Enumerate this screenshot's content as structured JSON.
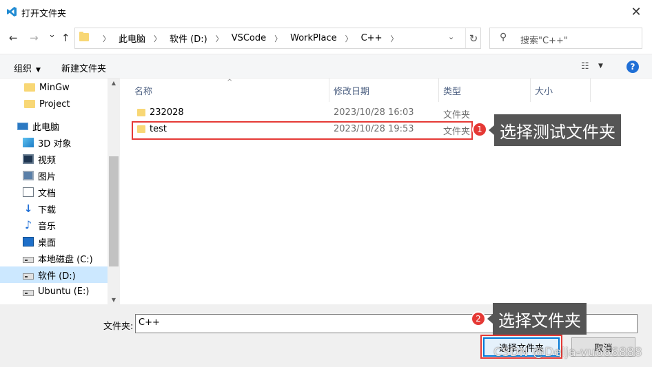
{
  "window": {
    "title": "打开文件夹",
    "close_glyph": "✕"
  },
  "nav": {
    "back_glyph": "←",
    "forward_glyph": "→",
    "recent_glyph": "⌄",
    "up_glyph": "↑",
    "breadcrumbs": [
      "此电脑",
      "软件 (D:)",
      "VSCode",
      "WorkPlace",
      "C++"
    ],
    "refresh_glyph": "↻",
    "search_placeholder": "搜索\"C++\""
  },
  "toolbar": {
    "organize_label": "组织",
    "new_folder_label": "新建文件夹",
    "help_label": "?"
  },
  "sidebar": {
    "items": [
      {
        "label": "MinGw",
        "icon": "folder-icon"
      },
      {
        "label": "Project",
        "icon": "folder-icon"
      },
      {
        "label": "此电脑",
        "icon": "computer-icon"
      },
      {
        "label": "3D 对象",
        "icon": "3d-objects-icon"
      },
      {
        "label": "视频",
        "icon": "video-icon"
      },
      {
        "label": "图片",
        "icon": "pictures-icon"
      },
      {
        "label": "文档",
        "icon": "documents-icon"
      },
      {
        "label": "下载",
        "icon": "download-icon"
      },
      {
        "label": "音乐",
        "icon": "music-icon"
      },
      {
        "label": "桌面",
        "icon": "desktop-icon"
      },
      {
        "label": "本地磁盘 (C:)",
        "icon": "drive-icon"
      },
      {
        "label": "软件 (D:)",
        "icon": "drive-icon",
        "selected": true
      },
      {
        "label": "Ubuntu (E:)",
        "icon": "drive-icon"
      }
    ]
  },
  "filelist": {
    "columns": [
      "名称",
      "修改日期",
      "类型",
      "大小"
    ],
    "rows": [
      {
        "name": "232028",
        "date": "2023/10/28 16:03",
        "type": "文件夹"
      },
      {
        "name": "test",
        "date": "2023/10/28 19:53",
        "type": "文件夹"
      }
    ]
  },
  "bottom": {
    "folder_label": "文件夹:",
    "folder_value": "C++",
    "select_button": "选择文件夹",
    "cancel_button": "取消"
  },
  "annotations": [
    {
      "number": "1",
      "text": "选择测试文件夹"
    },
    {
      "number": "2",
      "text": "选择文件夹"
    }
  ],
  "watermark": "CSDN @Delja-vu666888",
  "colors": {
    "accent": "#0078d7",
    "highlight": "#e53935",
    "annotation_bg": "#555555",
    "selected_bg": "#cce8ff",
    "folder": "#f8d775"
  }
}
